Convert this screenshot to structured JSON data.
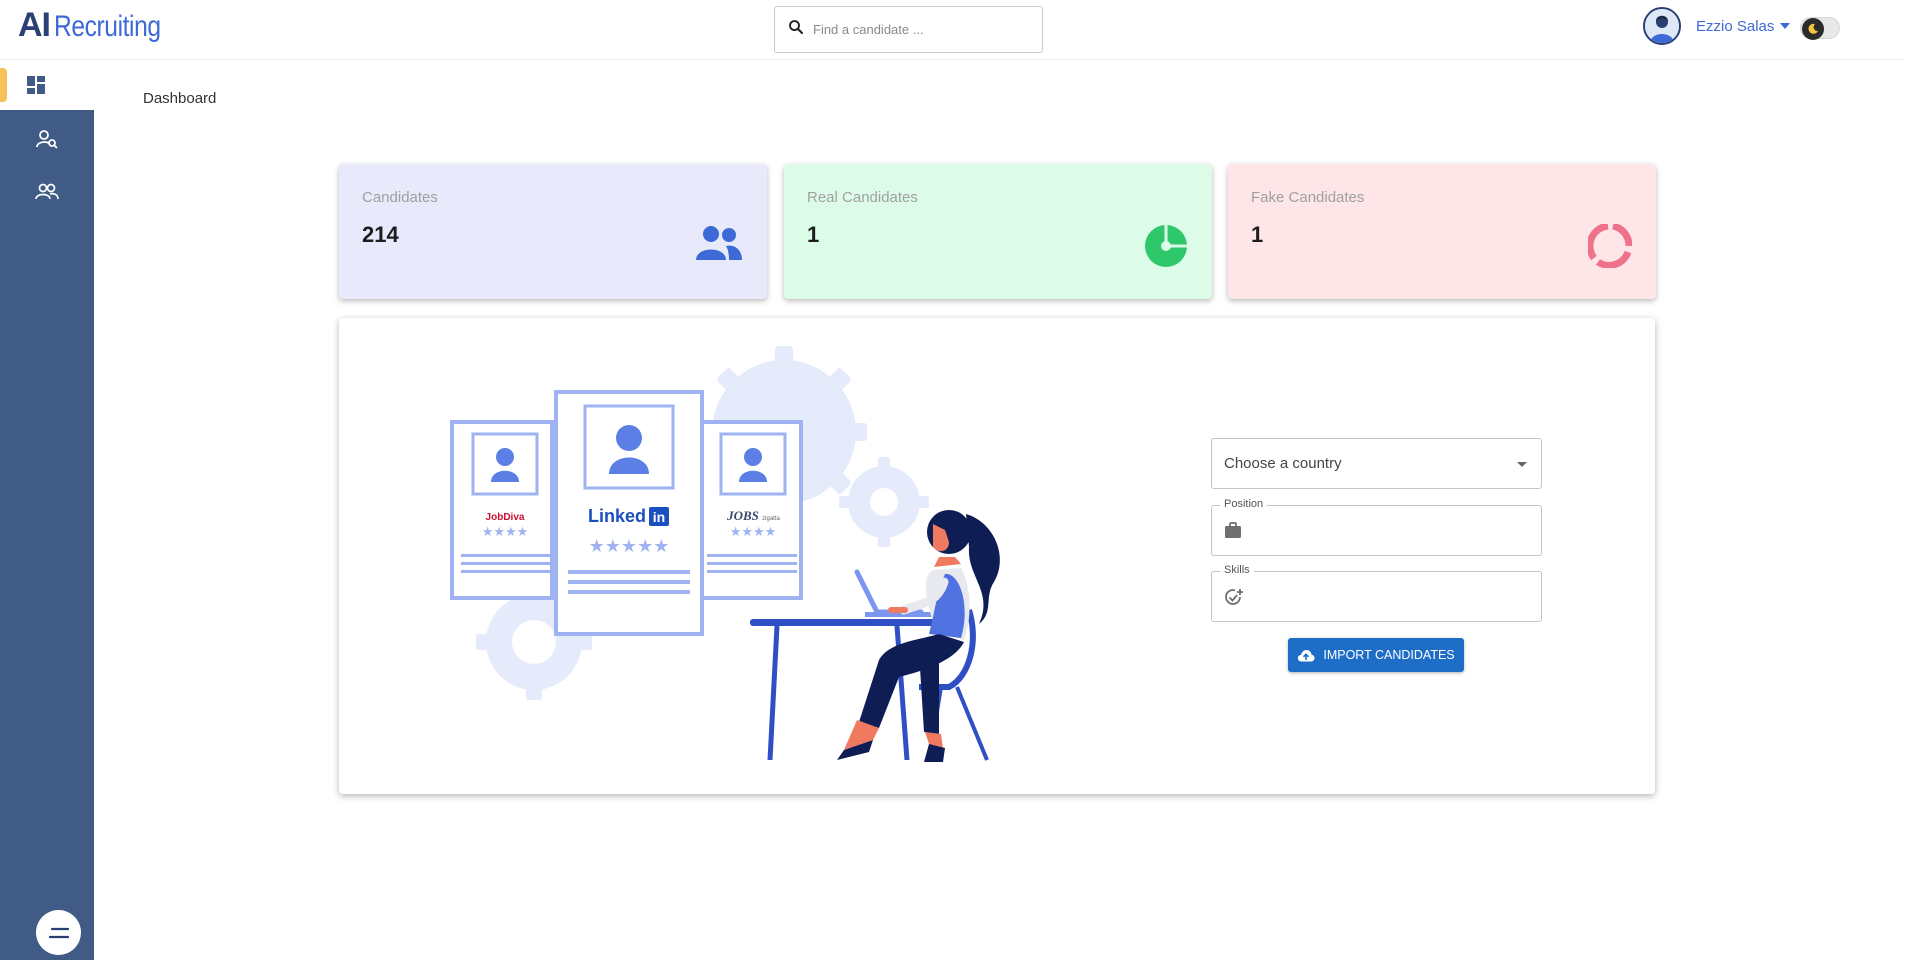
{
  "brand": {
    "logo_ai": "AI",
    "logo_rest": "Recruiting"
  },
  "search": {
    "placeholder": "Find a candidate ..."
  },
  "user": {
    "name": "Ezzio Salas"
  },
  "theme_toggle": {
    "icon": "moon-icon"
  },
  "sidebar": {
    "items": [
      {
        "icon": "dashboard-icon",
        "active": true
      },
      {
        "icon": "person-search-icon",
        "active": false
      },
      {
        "icon": "group-icon",
        "active": false
      }
    ],
    "menu_icon": "menu-icon"
  },
  "breadcrumb": {
    "title": "Dashboard"
  },
  "cards": [
    {
      "label": "Candidates",
      "value": "214",
      "icon": "users-icon",
      "color": "#3d6ad6",
      "bg": "#e8eafb"
    },
    {
      "label": "Real Candidates",
      "value": "1",
      "icon": "pie-chart-icon",
      "color": "#2ec86b",
      "bg": "#dcfce9"
    },
    {
      "label": "Fake Candidates",
      "value": "1",
      "icon": "donut-icon",
      "color": "#f0728a",
      "bg": "#fde5e8"
    }
  ],
  "form": {
    "country_placeholder": "Choose a country",
    "position_label": "Position",
    "position_value": "",
    "skills_label": "Skills",
    "skills_value": "",
    "import_label": "IMPORT CANDIDATES"
  },
  "illustration": {
    "profiles": [
      "JobDiva",
      "Linked",
      "in",
      "JOBS",
      "zigatta"
    ]
  }
}
